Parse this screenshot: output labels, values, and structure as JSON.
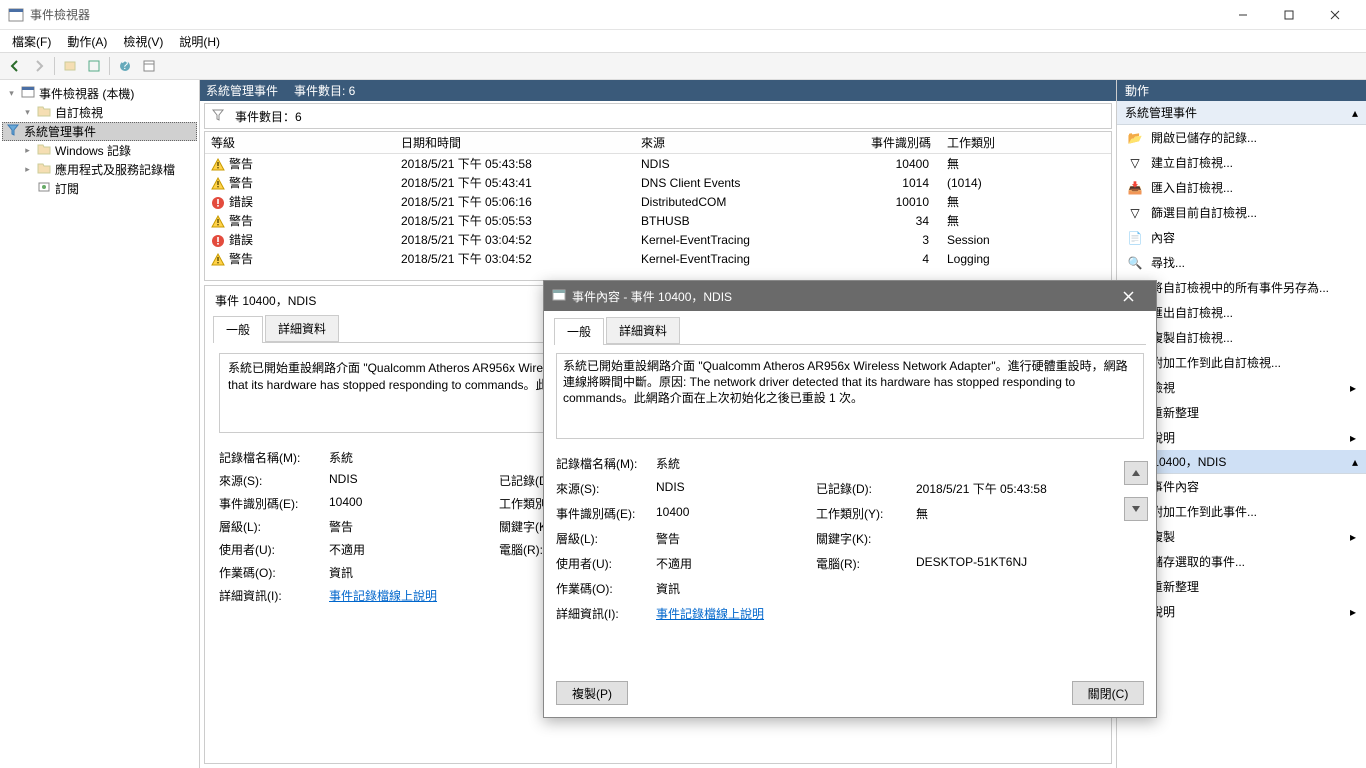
{
  "window": {
    "title": "事件檢視器"
  },
  "menu": {
    "file": "檔案(F)",
    "action": "動作(A)",
    "view": "檢視(V)",
    "help": "說明(H)"
  },
  "tree": {
    "root": "事件檢視器 (本機)",
    "custom": "自訂檢視",
    "admin": "系統管理事件",
    "winlogs": "Windows 記錄",
    "appsvc": "應用程式及服務記錄檔",
    "subs": "訂閱"
  },
  "header": {
    "title": "系統管理事件",
    "count_label": "事件數目: 6"
  },
  "filter": {
    "count_label": "事件數目：6"
  },
  "columns": {
    "level": "等級",
    "date": "日期和時間",
    "source": "來源",
    "id": "事件識別碼",
    "cat": "工作類別"
  },
  "events": [
    {
      "level": "warn",
      "level_txt": "警告",
      "date": "2018/5/21 下午 05:43:58",
      "source": "NDIS",
      "id": "10400",
      "cat": "無"
    },
    {
      "level": "warn",
      "level_txt": "警告",
      "date": "2018/5/21 下午 05:43:41",
      "source": "DNS Client Events",
      "id": "1014",
      "cat": "(1014)"
    },
    {
      "level": "err",
      "level_txt": "錯誤",
      "date": "2018/5/21 下午 05:06:16",
      "source": "DistributedCOM",
      "id": "10010",
      "cat": "無"
    },
    {
      "level": "warn",
      "level_txt": "警告",
      "date": "2018/5/21 下午 05:05:53",
      "source": "BTHUSB",
      "id": "34",
      "cat": "無"
    },
    {
      "level": "err",
      "level_txt": "錯誤",
      "date": "2018/5/21 下午 03:04:52",
      "source": "Kernel-EventTracing",
      "id": "3",
      "cat": "Session"
    },
    {
      "level": "warn",
      "level_txt": "警告",
      "date": "2018/5/21 下午 03:04:52",
      "source": "Kernel-EventTracing",
      "id": "4",
      "cat": "Logging"
    }
  ],
  "detail": {
    "title": "事件 10400，NDIS",
    "tab_general": "一般",
    "tab_details": "詳細資料",
    "message_short": "系統已開始重設網路介面 \"Qualcomm Atheros AR956x Wireless Network Adapter\"。進行硬體重設時，網路連線將瞬間中斷。原因: The network driver detected that its hardware has stopped responding to commands。此網路介面在上次初始化之後已重設 1 次。",
    "message_trunc": "系統已開始重設網路介面 \"Qualcomm Atheros AR956x Wireless Network Adapter\"。進行硬體重設時，網路連線將瞬間中斷。原因: The network driver detected that its hardware has stopped responding to commands。此網路介面在上",
    "labels": {
      "logname": "記錄檔名稱(M):",
      "source": "來源(S):",
      "logged": "已記錄(D):",
      "eventid": "事件識別碼(E):",
      "taskcat": "工作類別(Y):",
      "level": "層級(L):",
      "keywords": "關鍵字(K):",
      "user": "使用者(U):",
      "computer": "電腦(R):",
      "opcode": "作業碼(O):",
      "moreinfo": "詳細資訊(I):"
    },
    "values": {
      "logname": "系統",
      "source": "NDIS",
      "logged": "2018/5/21 下午 05:43:58",
      "eventid": "10400",
      "taskcat": "無",
      "level": "警告",
      "keywords": "",
      "user": "不適用",
      "computer": "DESKTOP-51KT6NJ",
      "opcode": "資訊",
      "moreinfo": "事件記錄檔線上說明"
    }
  },
  "dialog": {
    "title": "事件內容 - 事件 10400，NDIS",
    "copy": "複製(P)",
    "close": "關閉(C)"
  },
  "actions": {
    "header": "動作",
    "sec1": "系統管理事件",
    "items1": [
      "開啟已儲存的記錄...",
      "建立自訂檢視...",
      "匯入自訂檢視...",
      "篩選目前自訂檢視...",
      "內容",
      "尋找...",
      "將自訂檢視中的所有事件另存為...",
      "匯出自訂檢視...",
      "複製自訂檢視...",
      "附加工作到此自訂檢視...",
      "檢視",
      "重新整理",
      "說明"
    ],
    "sec2": "事件 10400，NDIS",
    "items2": [
      "事件內容",
      "附加工作到此事件...",
      "複製",
      "儲存選取的事件...",
      "重新整理",
      "說明"
    ]
  }
}
